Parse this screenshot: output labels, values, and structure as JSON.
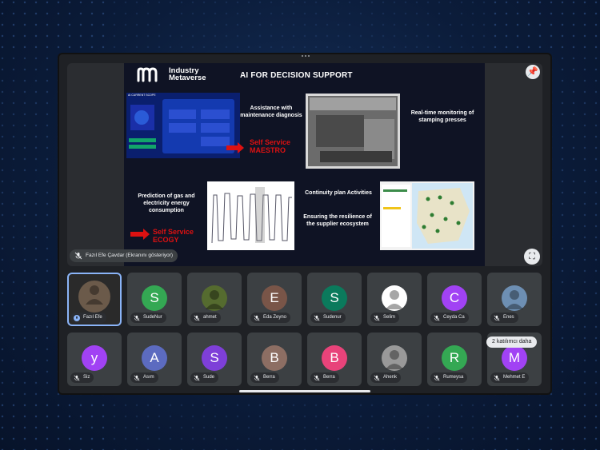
{
  "presenter": {
    "name_label": "Fazıl Efe Çavdar (Ekranını gösteriyor)"
  },
  "slide": {
    "brand_line1": "Industry",
    "brand_line2": "Metaverse",
    "title": "AI FOR DECISION SUPPORT",
    "block1_text": "Assistance with maintenance diagnosis",
    "block1_product": "Self Service MAESTRO",
    "block2_text": "Real-time monitoring of stamping presses",
    "block3_text": "Prediction of gas and electricity energy consumption",
    "block3_product": "Self Service ECOGY",
    "block4_line1": "Continuity plan Activities",
    "block4_line2": "Ensuring the resilience of the supplier ecosystem",
    "diagram_caption": "AI CURRENT SCOPE"
  },
  "participants_row1": [
    {
      "initial": "",
      "name": "Fazıl Efe",
      "color": "#4a4a4a",
      "photo": true,
      "active": true
    },
    {
      "initial": "S",
      "name": "SudeNur",
      "color": "#34a853"
    },
    {
      "initial": "",
      "name": "ahmet",
      "color": "#556b2f",
      "photo": true
    },
    {
      "initial": "E",
      "name": "Eda Zeyno",
      "color": "#795548"
    },
    {
      "initial": "S",
      "name": "Sudenur",
      "color": "#0b7a5c"
    },
    {
      "initial": "",
      "name": "Selim",
      "color": "#ffffff",
      "photo": true
    },
    {
      "initial": "C",
      "name": "Ceyda Ca",
      "color": "#a142f4"
    },
    {
      "initial": "",
      "name": "Enes",
      "color": "#6d8fb3",
      "photo": true
    }
  ],
  "participants_row2": [
    {
      "initial": "y",
      "name": "Siz",
      "color": "#a142f4"
    },
    {
      "initial": "A",
      "name": "Asım",
      "color": "#5c6bc0"
    },
    {
      "initial": "S",
      "name": "Sude",
      "color": "#7e3fd8"
    },
    {
      "initial": "B",
      "name": "Berra",
      "color": "#8d6e63"
    },
    {
      "initial": "B",
      "name": "Berra",
      "color": "#e8437a"
    },
    {
      "initial": "",
      "name": "Ahenk",
      "color": "#999999",
      "photo": true
    },
    {
      "initial": "R",
      "name": "Rumeysa",
      "color": "#34a853"
    },
    {
      "initial": "M",
      "name": "Mehmet E",
      "color": "#a142f4"
    }
  ],
  "more_participants_label": "2 katılımcı daha",
  "icons": {
    "pin": "pin-icon",
    "expand": "fullscreen-icon",
    "mic_off": "mic-off-icon",
    "mic_on": "mic-on-icon"
  }
}
